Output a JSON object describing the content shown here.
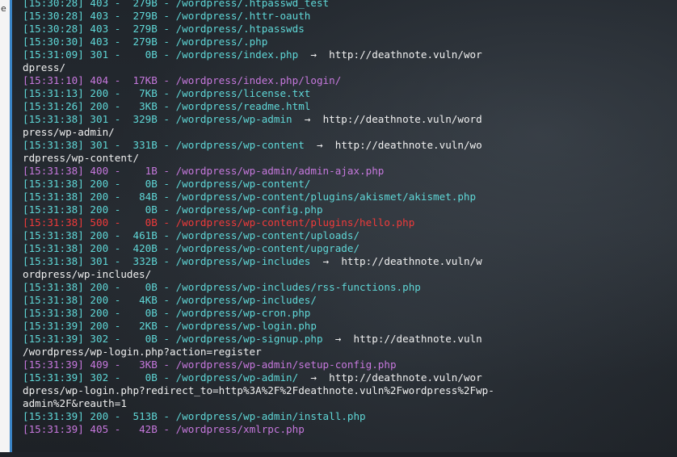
{
  "window": {
    "side_glyph": "e"
  },
  "lines": [
    {
      "kind": "log",
      "cls": "c403",
      "ts": "[15:30:28]",
      "code": "403",
      "size": "279B",
      "path": "/wordpress/.htpasswd_test"
    },
    {
      "kind": "log",
      "cls": "c403",
      "ts": "[15:30:28]",
      "code": "403",
      "size": "279B",
      "path": "/wordpress/.httr-oauth"
    },
    {
      "kind": "log",
      "cls": "c403",
      "ts": "[15:30:28]",
      "code": "403",
      "size": "279B",
      "path": "/wordpress/.htpasswds"
    },
    {
      "kind": "log",
      "cls": "c403",
      "ts": "[15:30:30]",
      "code": "403",
      "size": "279B",
      "path": "/wordpress/.php"
    },
    {
      "kind": "log",
      "cls": "c301",
      "ts": "[15:31:09]",
      "code": "301",
      "size": "0B",
      "path": "/wordpress/index.php",
      "redirect": "http://deathnote.vuln/wor"
    },
    {
      "kind": "wrap",
      "text": "dpress/"
    },
    {
      "kind": "log",
      "cls": "c404",
      "ts": "[15:31:10]",
      "code": "404",
      "size": "17KB",
      "path": "/wordpress/index.php/login/"
    },
    {
      "kind": "log",
      "cls": "c200",
      "ts": "[15:31:13]",
      "code": "200",
      "size": "7KB",
      "path": "/wordpress/license.txt"
    },
    {
      "kind": "log",
      "cls": "c200",
      "ts": "[15:31:26]",
      "code": "200",
      "size": "3KB",
      "path": "/wordpress/readme.html"
    },
    {
      "kind": "log",
      "cls": "c301",
      "ts": "[15:31:38]",
      "code": "301",
      "size": "329B",
      "path": "/wordpress/wp-admin",
      "redirect": "http://deathnote.vuln/word"
    },
    {
      "kind": "wrap",
      "text": "press/wp-admin/"
    },
    {
      "kind": "log",
      "cls": "c301",
      "ts": "[15:31:38]",
      "code": "301",
      "size": "331B",
      "path": "/wordpress/wp-content",
      "redirect": "http://deathnote.vuln/wo"
    },
    {
      "kind": "wrap",
      "text": "rdpress/wp-content/"
    },
    {
      "kind": "log",
      "cls": "c400",
      "ts": "[15:31:38]",
      "code": "400",
      "size": "1B",
      "path": "/wordpress/wp-admin/admin-ajax.php"
    },
    {
      "kind": "log",
      "cls": "c200",
      "ts": "[15:31:38]",
      "code": "200",
      "size": "0B",
      "path": "/wordpress/wp-content/"
    },
    {
      "kind": "log",
      "cls": "c200",
      "ts": "[15:31:38]",
      "code": "200",
      "size": "84B",
      "path": "/wordpress/wp-content/plugins/akismet/akismet.php"
    },
    {
      "kind": "log",
      "cls": "c200",
      "ts": "[15:31:38]",
      "code": "200",
      "size": "0B",
      "path": "/wordpress/wp-config.php"
    },
    {
      "kind": "log",
      "cls": "c500",
      "ts": "[15:31:38]",
      "code": "500",
      "size": "0B",
      "path": "/wordpress/wp-content/plugins/hello.php"
    },
    {
      "kind": "log",
      "cls": "c200",
      "ts": "[15:31:38]",
      "code": "200",
      "size": "461B",
      "path": "/wordpress/wp-content/uploads/"
    },
    {
      "kind": "log",
      "cls": "c200",
      "ts": "[15:31:38]",
      "code": "200",
      "size": "420B",
      "path": "/wordpress/wp-content/upgrade/"
    },
    {
      "kind": "log",
      "cls": "c301",
      "ts": "[15:31:38]",
      "code": "301",
      "size": "332B",
      "path": "/wordpress/wp-includes",
      "redirect": "http://deathnote.vuln/w"
    },
    {
      "kind": "wrap",
      "text": "ordpress/wp-includes/"
    },
    {
      "kind": "log",
      "cls": "c200",
      "ts": "[15:31:38]",
      "code": "200",
      "size": "0B",
      "path": "/wordpress/wp-includes/rss-functions.php"
    },
    {
      "kind": "log",
      "cls": "c200",
      "ts": "[15:31:38]",
      "code": "200",
      "size": "4KB",
      "path": "/wordpress/wp-includes/"
    },
    {
      "kind": "log",
      "cls": "c200",
      "ts": "[15:31:38]",
      "code": "200",
      "size": "0B",
      "path": "/wordpress/wp-cron.php"
    },
    {
      "kind": "log",
      "cls": "c200",
      "ts": "[15:31:39]",
      "code": "200",
      "size": "2KB",
      "path": "/wordpress/wp-login.php"
    },
    {
      "kind": "log",
      "cls": "c302",
      "ts": "[15:31:39]",
      "code": "302",
      "size": "0B",
      "path": "/wordpress/wp-signup.php",
      "redirect": "http://deathnote.vuln"
    },
    {
      "kind": "wrap",
      "text": "/wordpress/wp-login.php?action=register"
    },
    {
      "kind": "log",
      "cls": "c409",
      "ts": "[15:31:39]",
      "code": "409",
      "size": "3KB",
      "path": "/wordpress/wp-admin/setup-config.php"
    },
    {
      "kind": "log",
      "cls": "c302",
      "ts": "[15:31:39]",
      "code": "302",
      "size": "0B",
      "path": "/wordpress/wp-admin/",
      "redirect": "http://deathnote.vuln/wor"
    },
    {
      "kind": "wrap",
      "text": "dpress/wp-login.php?redirect_to=http%3A%2F%2Fdeathnote.vuln%2Fwordpress%2Fwp-"
    },
    {
      "kind": "wrap",
      "text": "admin%2F&reauth=1"
    },
    {
      "kind": "log",
      "cls": "c200",
      "ts": "[15:31:39]",
      "code": "200",
      "size": "513B",
      "path": "/wordpress/wp-admin/install.php"
    },
    {
      "kind": "log",
      "cls": "c405",
      "ts": "[15:31:39]",
      "code": "405",
      "size": "42B",
      "path": "/wordpress/xmlrpc.php"
    }
  ],
  "arrow": "→",
  "sep": "-"
}
